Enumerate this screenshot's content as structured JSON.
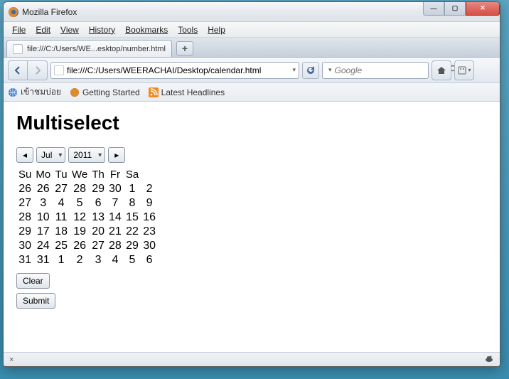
{
  "window": {
    "title": "Mozilla Firefox",
    "controls": {
      "minimize": "—",
      "maximize": "▢",
      "close": "✕"
    }
  },
  "menubar": [
    "File",
    "Edit",
    "View",
    "History",
    "Bookmarks",
    "Tools",
    "Help"
  ],
  "tab": {
    "title": "file:///C:/Users/WE...esktop/number.html"
  },
  "newtab": "+",
  "nav": {
    "url": "file:///C:/Users/WEERACHAI/Desktop/calendar.html",
    "search_placeholder": "Google"
  },
  "bookmarks": [
    {
      "icon": "globe-blue",
      "label": "เข้าชมบ่อย"
    },
    {
      "icon": "firefox",
      "label": "Getting Started"
    },
    {
      "icon": "rss",
      "label": "Latest Headlines"
    }
  ],
  "page": {
    "heading": "Multiselect",
    "nav": {
      "prev": "◂",
      "month": "Jul",
      "year": "2011",
      "next": "▸"
    },
    "dow": [
      "Su",
      "Mo",
      "Tu",
      "We",
      "Th",
      "Fr",
      "Sa"
    ],
    "weeks": [
      [
        "26",
        "26",
        "27",
        "28",
        "29",
        "30",
        "1",
        "2"
      ],
      [
        "27",
        "3",
        "4",
        "5",
        "6",
        "7",
        "8",
        "9"
      ],
      [
        "28",
        "10",
        "11",
        "12",
        "13",
        "14",
        "15",
        "16"
      ],
      [
        "29",
        "17",
        "18",
        "19",
        "20",
        "21",
        "22",
        "23"
      ],
      [
        "30",
        "24",
        "25",
        "26",
        "27",
        "28",
        "29",
        "30"
      ],
      [
        "31",
        "31",
        "1",
        "2",
        "3",
        "4",
        "5",
        "6"
      ]
    ],
    "clear": "Clear",
    "submit": "Submit"
  },
  "status": {
    "left": "×",
    "right": ""
  }
}
